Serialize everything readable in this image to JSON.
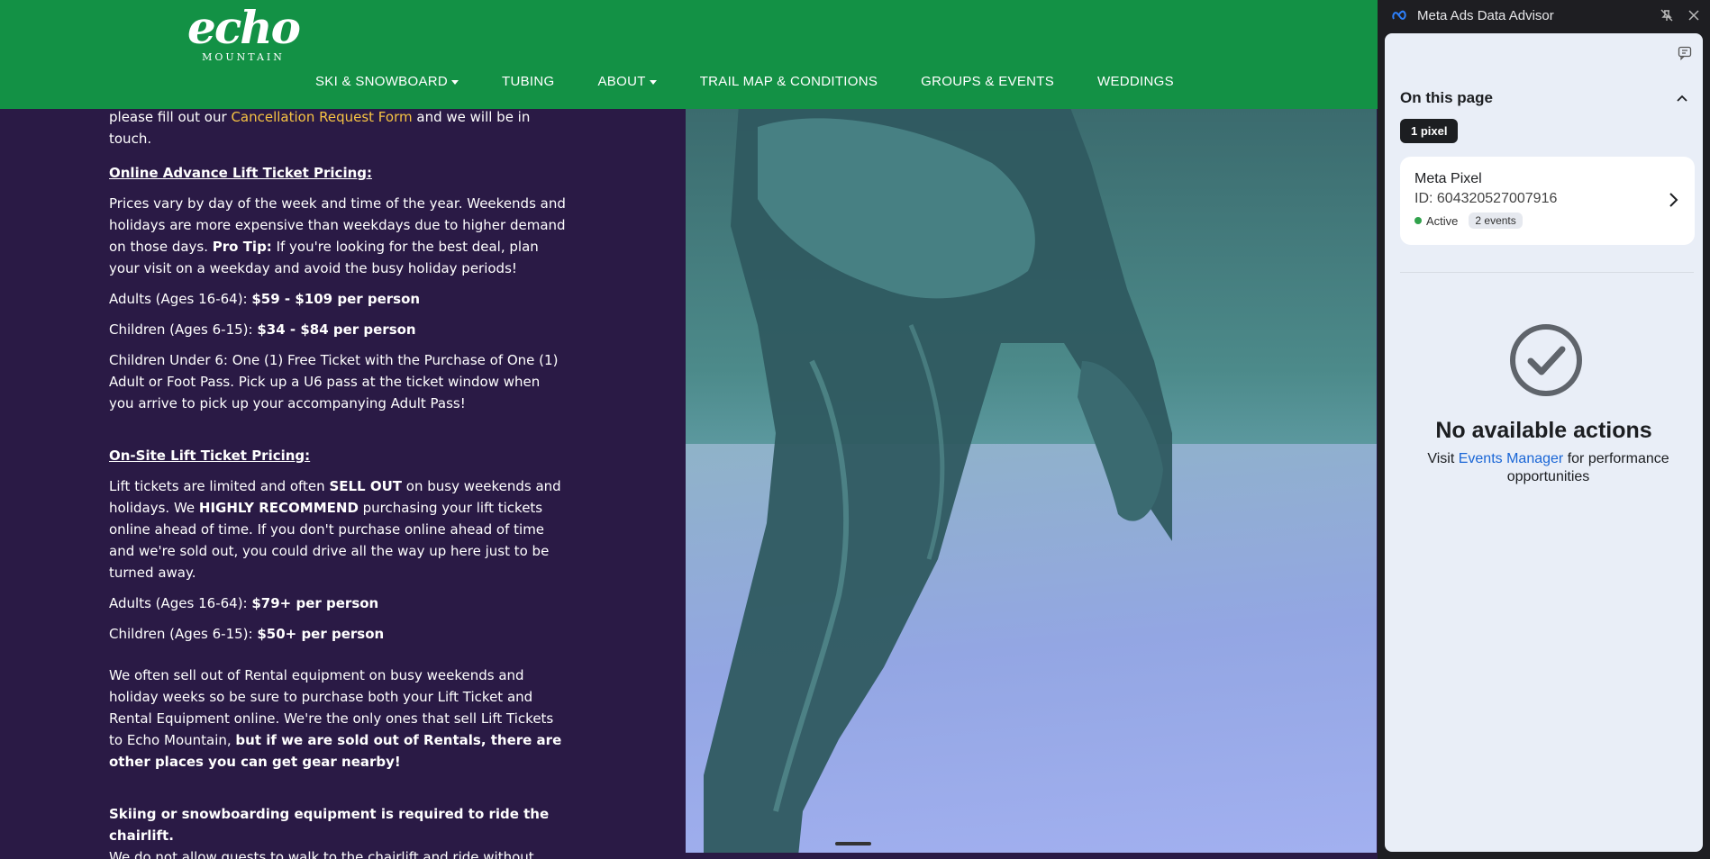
{
  "site": {
    "logo": {
      "word": "echo",
      "sub": "MOUNTAIN"
    },
    "nav": [
      {
        "label": "SKI & SNOWBOARD",
        "dropdown": true
      },
      {
        "label": "TUBING",
        "dropdown": false
      },
      {
        "label": "ABOUT",
        "dropdown": true
      },
      {
        "label": "TRAIL MAP & CONDITIONS",
        "dropdown": false
      },
      {
        "label": "GROUPS & EVENTS",
        "dropdown": false
      },
      {
        "label": "WEDDINGS",
        "dropdown": false
      }
    ],
    "content": {
      "cancel_pre": "please fill out our ",
      "cancel_link": "Cancellation Request Form",
      "cancel_post": " and we will be in touch.",
      "online_heading": "Online Advance Lift Ticket Pricing:",
      "online_p1_a": "Prices vary by day of the week and time of the year. Weekends and holidays are more expensive than weekdays due to higher demand on those days. ",
      "online_p1_tip": "Pro Tip:",
      "online_p1_b": " If you're looking for the best deal, plan your visit on a weekday and avoid the busy holiday periods!",
      "online_adults_label": "Adults (Ages 16-64): ",
      "online_adults_price": "$59 - $109 per person",
      "online_children_label": "Children (Ages 6-15): ",
      "online_children_price": "$34 - $84 per person",
      "online_under6": "Children Under 6: One (1) Free Ticket with the Purchase of One (1) Adult or Foot Pass. Pick up a U6 pass at the ticket window when you arrive to pick up your accompanying Adult Pass!",
      "onsite_heading": "On-Site Lift Ticket Pricing:",
      "onsite_p1_a": "Lift tickets are limited and often ",
      "onsite_p1_sell": "SELL OUT",
      "onsite_p1_b": " on busy weekends and holidays. We ",
      "onsite_p1_rec": "HIGHLY RECOMMEND",
      "onsite_p1_c": " purchasing your lift tickets online ahead of time. If you don't purchase online ahead of time and we're sold out, you could drive all the way up here just to be turned away.",
      "onsite_adults_label": "Adults (Ages 16-64): ",
      "onsite_adults_price": "$79+ per person",
      "onsite_children_label": "Children (Ages 6-15): ",
      "onsite_children_price": "$50+ per person",
      "rental_a": "We often sell out of Rental equipment on busy weekends and holiday weeks so be sure to purchase both your Lift Ticket and Rental Equipment online. We're the only ones that sell Lift Tickets to Echo Mountain, ",
      "rental_b": "but if we are sold out of Rentals, there are other places you can get gear nearby!",
      "equipment_bold": "Skiing or snowboarding equipment is required to ride the chairlift.",
      "equipment_text": "We do not allow guests to walk to the chairlift and ride without equipment on your feet."
    },
    "colors": {
      "header": "#139145",
      "background": "#2a1a45",
      "link": "#f6c343"
    }
  },
  "extension": {
    "title": "Meta Ads Data Advisor",
    "section_title": "On this page",
    "pixel_count": "1 pixel",
    "pixel": {
      "name": "Meta Pixel",
      "id": "ID: 604320527007916",
      "status": "Active",
      "events": "2 events"
    },
    "empty": {
      "title": "No available actions",
      "text_pre": "Visit ",
      "link": "Events Manager",
      "text_post": " for performance opportunities"
    },
    "icons": [
      "meta-icon",
      "unpin-icon",
      "close-icon",
      "feedback-icon",
      "chevron-up-icon",
      "chevron-right-icon",
      "check-circle-icon"
    ]
  }
}
